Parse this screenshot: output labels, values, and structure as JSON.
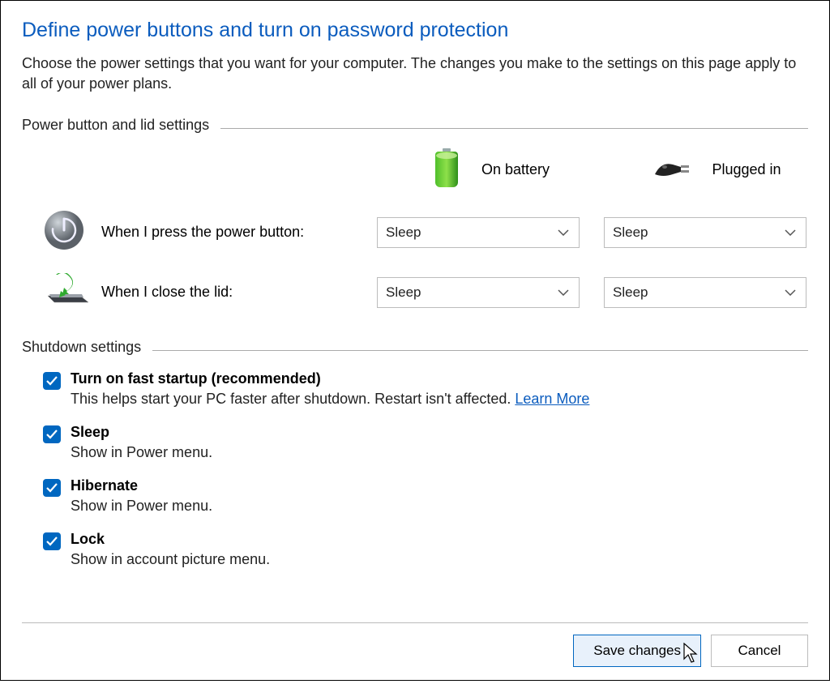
{
  "title": "Define power buttons and turn on password protection",
  "description": "Choose the power settings that you want for your computer. The changes you make to the settings on this page apply to all of your power plans.",
  "sections": {
    "power_lid": {
      "header": "Power button and lid settings",
      "columns": {
        "battery": "On battery",
        "plugged": "Plugged in"
      },
      "rows": {
        "power_button": {
          "label": "When I press the power button:",
          "battery_value": "Sleep",
          "plugged_value": "Sleep"
        },
        "close_lid": {
          "label": "When I close the lid:",
          "battery_value": "Sleep",
          "plugged_value": "Sleep"
        }
      }
    },
    "shutdown": {
      "header": "Shutdown settings",
      "items": {
        "fast_startup": {
          "checked": true,
          "title": "Turn on fast startup (recommended)",
          "desc": "This helps start your PC faster after shutdown. Restart isn't affected. ",
          "link": "Learn More"
        },
        "sleep": {
          "checked": true,
          "title": "Sleep",
          "desc": "Show in Power menu."
        },
        "hibernate": {
          "checked": true,
          "title": "Hibernate",
          "desc": "Show in Power menu."
        },
        "lock": {
          "checked": true,
          "title": "Lock",
          "desc": "Show in account picture menu."
        }
      }
    }
  },
  "footer": {
    "save": "Save changes",
    "cancel": "Cancel"
  }
}
